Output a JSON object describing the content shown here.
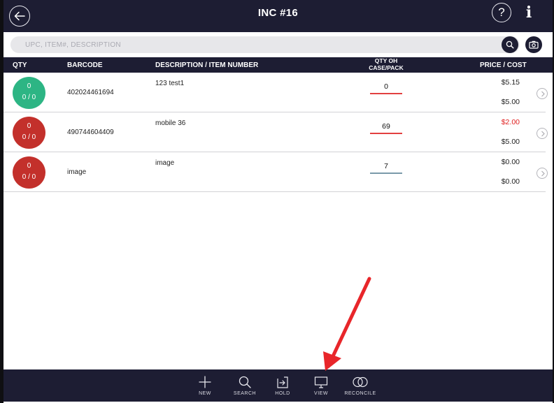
{
  "header": {
    "title": "INC #16"
  },
  "search": {
    "placeholder": "UPC, ITEM#, DESCRIPTION"
  },
  "table": {
    "columns": {
      "qty": "QTY",
      "barcode": "BARCODE",
      "description": "DESCRIPTION / ITEM NUMBER",
      "qty_oh_line1": "QTY OH",
      "qty_oh_line2": "CASE/PACK",
      "price_cost": "PRICE / COST"
    },
    "rows": [
      {
        "qty": "0",
        "case_pack": "0 / 0",
        "barcode": "402024461694",
        "description": "123 test1",
        "qty_oh": "0",
        "price": "$5.15",
        "cost": "$5.00",
        "badge_color": "#2db584",
        "line_color": "#e24040",
        "price_color": "#222222"
      },
      {
        "qty": "0",
        "case_pack": "0 / 0",
        "barcode": "490744604409",
        "description": "mobile 36",
        "qty_oh": "69",
        "price": "$2.00",
        "cost": "$5.00",
        "badge_color": "#c3302b",
        "line_color": "#e24040",
        "price_color": "#e02020"
      },
      {
        "qty": "0",
        "case_pack": "0 / 0",
        "barcode": "image",
        "description": "image",
        "qty_oh": "7",
        "price": "$0.00",
        "cost": "$0.00",
        "badge_color": "#c3302b",
        "line_color": "#7a9aaa",
        "price_color": "#222222"
      }
    ]
  },
  "footer": {
    "new": "NEW",
    "search": "SEARCH",
    "hold": "HOLD",
    "view": "VIEW",
    "reconcile": "RECONCILE"
  },
  "colors": {
    "navy": "#1d1d33",
    "annotation_red": "#e8262a"
  },
  "icons": [
    "back-arrow-icon",
    "help-icon",
    "info-icon",
    "search-icon",
    "camera-icon",
    "chevron-right-icon",
    "plus-icon",
    "search-icon",
    "hold-icon",
    "view-monitor-icon",
    "reconcile-icon"
  ]
}
